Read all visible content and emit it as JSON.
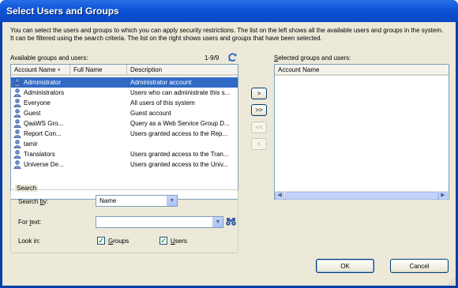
{
  "window": {
    "title": "Select Users and Groups"
  },
  "intro": "You can select the users and groups to which you can apply security restrictions. The list on the left shows all the available users and groups in the system.  It can be filtered using the search criteria. The list on the right shows users and groups that have been selected.",
  "available": {
    "label": "Available groups and users:",
    "count": "1-9/9",
    "columns": [
      "Account Name",
      "Full Name",
      "Description"
    ],
    "rows": [
      {
        "account": "Administrator",
        "full": "",
        "desc": "Administrator account",
        "selected": true
      },
      {
        "account": "Administrators",
        "full": "",
        "desc": "Users who can administrate this s...",
        "selected": false
      },
      {
        "account": "Everyone",
        "full": "",
        "desc": "All users of this system",
        "selected": false
      },
      {
        "account": "Guest",
        "full": "",
        "desc": "Guest account",
        "selected": false
      },
      {
        "account": "QaaWS Gro...",
        "full": "",
        "desc": "Query as a Web Service Group D...",
        "selected": false
      },
      {
        "account": "Report Con...",
        "full": "",
        "desc": "Users granted access to the Rep...",
        "selected": false
      },
      {
        "account": "tamir",
        "full": "",
        "desc": "",
        "selected": false
      },
      {
        "account": "Translators",
        "full": "",
        "desc": "Users granted access to the Tran...",
        "selected": false
      },
      {
        "account": "Universe De...",
        "full": "",
        "desc": "Users granted access to the Univ...",
        "selected": false
      }
    ]
  },
  "transfer": {
    "add": ">",
    "add_all": ">>",
    "remove_all": "<<",
    "remove": "<"
  },
  "selected": {
    "label": "Selected groups and users:",
    "columns": [
      "Account Name"
    ]
  },
  "search": {
    "legend": "Search",
    "search_by_label": "Search by:",
    "search_by_value": "Name",
    "for_text_label": "For text:",
    "for_text_value": "",
    "look_in_label": "Look in:",
    "groups_label": "Groups",
    "users_label": "Users",
    "groups_checked": true,
    "users_checked": true
  },
  "buttons": {
    "ok": "OK",
    "cancel": "Cancel"
  },
  "colors": {
    "selection": "#316ac5",
    "titlebar": "#0c53d6",
    "dialog_bg": "#ece9d8"
  }
}
